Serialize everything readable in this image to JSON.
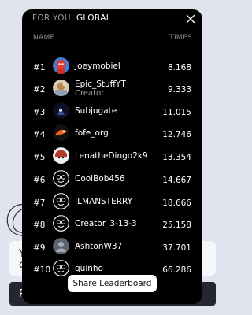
{
  "tabs": [
    {
      "label": "FOR YOU",
      "active": false
    },
    {
      "label": "GLOBAL",
      "active": true
    }
  ],
  "close_icon": "close-icon",
  "columns": {
    "name": "NAME",
    "times": "TIMES"
  },
  "rows": [
    {
      "rank": "#1",
      "name": "Joeymobiel",
      "time": "8.168",
      "avatar": "red-character-avatar"
    },
    {
      "rank": "#2",
      "name": "Epic_StuffYT",
      "sub": "Creator",
      "time": "9.333",
      "avatar": "photo-avatar"
    },
    {
      "rank": "#3",
      "name": "Subjugate",
      "time": "11.015",
      "avatar": "dark-avatar"
    },
    {
      "rank": "#4",
      "name": "fofe_org",
      "time": "12.746",
      "avatar": "orange-avatar"
    },
    {
      "rank": "#5",
      "name": "LenatheDingo2k9",
      "time": "13.354",
      "avatar": "anime-avatar"
    },
    {
      "rank": "#6",
      "name": "CoolBob456",
      "time": "14.667",
      "avatar": "default-avatar"
    },
    {
      "rank": "#7",
      "name": "ILMANSTERRY",
      "time": "18.666",
      "avatar": "default-avatar"
    },
    {
      "rank": "#8",
      "name": "Creator_3-13-3",
      "time": "25.158",
      "avatar": "default-avatar"
    },
    {
      "rank": "#9",
      "name": "AshtonW37",
      "time": "37.701",
      "avatar": "gray-avatar"
    },
    {
      "rank": "#10",
      "name": "quinho",
      "time": "66.286",
      "avatar": "default-avatar"
    }
  ],
  "share_button": "Share Leaderboard",
  "background": {
    "card_text_line1": "Y",
    "card_text_line2": "c",
    "button_text": "P"
  }
}
